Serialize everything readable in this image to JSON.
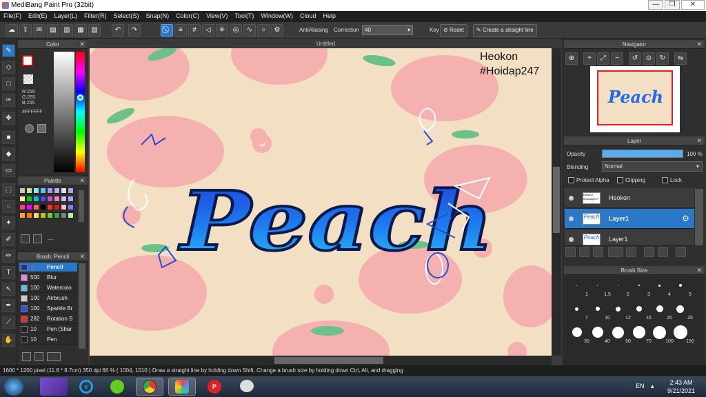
{
  "window": {
    "title": "MediBang Paint Pro (32bit)",
    "min": "—",
    "max": "❐",
    "close": "✕"
  },
  "menu": [
    "File(F)",
    "Edit(E)",
    "Layer(L)",
    "Filter(R)",
    "Select(S)",
    "Snap(N)",
    "Color(C)",
    "View(V)",
    "Tool(T)",
    "Window(W)",
    "Cloud",
    "Help"
  ],
  "toolbar": {
    "antialias_label": "AntiAliasing",
    "correction_label": "Correction",
    "correction_value": "40",
    "key_label": "Key",
    "reset_label": "Reset",
    "straight_label": "Create a straight line"
  },
  "color_panel": {
    "title": "Color",
    "r": "R:255",
    "g": "G:255",
    "b": "B:255",
    "hex": "#FFFFFF"
  },
  "palette_panel": {
    "title": "Palette",
    "colors": [
      "#c8c8c8",
      "#c8e8a0",
      "#80e8ff",
      "#58c8e8",
      "#a0a0f0",
      "#b0b0ff",
      "#e0e0e0",
      "#a8a8d8",
      "#ffff80",
      "#00d000",
      "#00c8c8",
      "#4848ff",
      "#d050d0",
      "#ff80c0",
      "#c0c0ff",
      "#a8a8ff",
      "#ff4080",
      "#ff00ff",
      "#ff6060",
      "#000000",
      "#ff3030",
      "#d02020",
      "#ffc0c0",
      "#8080ff",
      "#ffa040",
      "#ff8000",
      "#ffd080",
      "#c0c000",
      "#80c040",
      "#40a040",
      "#808080",
      "#a0ffa0"
    ],
    "footer": "---"
  },
  "brush_panel": {
    "title": "Brush: Pencil",
    "items": [
      {
        "size": "4",
        "name": "Pencil",
        "color": "#1a3a8a"
      },
      {
        "size": "500",
        "name": "Blur",
        "color": "#e08ae0"
      },
      {
        "size": "100",
        "name": "Watercolo",
        "color": "#60c0e8"
      },
      {
        "size": "100",
        "name": "Airbrush",
        "color": "#cccccc"
      },
      {
        "size": "100",
        "name": "Sparkle Br",
        "color": "#3050e0"
      },
      {
        "size": "282",
        "name": "Rotation S",
        "color": "#e03030"
      },
      {
        "size": "10",
        "name": "Pen (Shar",
        "color": "#222222"
      },
      {
        "size": "10",
        "name": "Pen",
        "color": "#222222"
      }
    ]
  },
  "document": {
    "tab": "Untitled",
    "watermark_line1": "Heokon",
    "watermark_line2": "#Hoidap247",
    "art_text": "Peach"
  },
  "navigator": {
    "title": "Navigator",
    "thumb_text": "Peach"
  },
  "layer_panel": {
    "title": "Layer",
    "opacity_label": "Opacity",
    "opacity_value": "100 %",
    "opacity_pct": 100,
    "blending_label": "Blending",
    "blending_value": "Normal",
    "protect_alpha": "Protect Alpha",
    "clipping": "Clipping",
    "lock": "Lock",
    "layers": [
      {
        "name": "Heokon",
        "thumb": "Heokon #Hoidap247",
        "selected": false
      },
      {
        "name": "Layer1",
        "thumb": "Peach",
        "selected": true
      },
      {
        "name": "Layer1",
        "thumb": "Peach",
        "selected": false
      }
    ]
  },
  "brush_size_panel": {
    "title": "Brush Size",
    "sizes": [
      "1",
      "1.5",
      "2",
      "3",
      "4",
      "5",
      "7",
      "10",
      "12",
      "15",
      "20",
      "25",
      "30",
      "40",
      "50",
      "70",
      "100",
      "150"
    ]
  },
  "status": {
    "text": "1600 * 1200 pixel  (11.6 * 8.7cm)  350 dpi  66 %  ( 1004, 1010 )  Draw a straight line by holding down Shift, Change a brush size by holding down Ctrl, Alt, and dragging"
  },
  "taskbar": {
    "lang": "EN",
    "time": "2:43 AM",
    "date": "9/21/2021"
  }
}
